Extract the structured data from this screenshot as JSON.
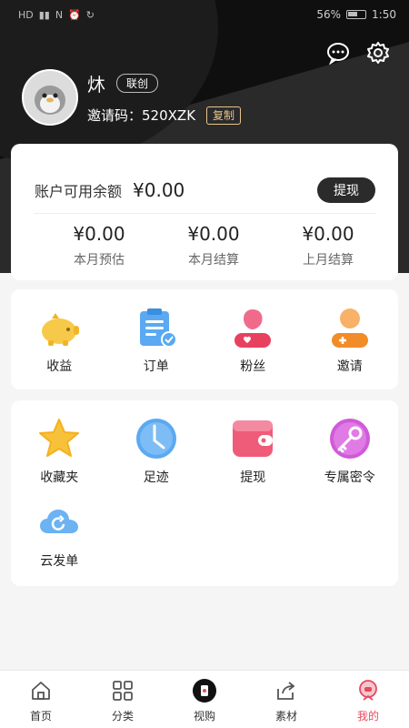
{
  "status_bar": {
    "battery_percent": "56%",
    "time": "1:50"
  },
  "profile": {
    "username": "炑",
    "role": "联创",
    "invite_label": "邀请码：",
    "invite_code": "520XZK",
    "copy_label": "复制"
  },
  "balance": {
    "label": "账户可用余额",
    "value": "¥0.00",
    "withdraw_label": "提现",
    "stats": [
      {
        "value": "¥0.00",
        "label": "本月预估"
      },
      {
        "value": "¥0.00",
        "label": "本月结算"
      },
      {
        "value": "¥0.00",
        "label": "上月结算"
      }
    ]
  },
  "menu1": [
    {
      "label": "收益",
      "icon": "piggy-bank-icon"
    },
    {
      "label": "订单",
      "icon": "clipboard-icon"
    },
    {
      "label": "粉丝",
      "icon": "fans-icon"
    },
    {
      "label": "邀请",
      "icon": "invite-user-icon"
    }
  ],
  "menu2": [
    {
      "label": "收藏夹",
      "icon": "star-icon"
    },
    {
      "label": "足迹",
      "icon": "clock-icon"
    },
    {
      "label": "提现",
      "icon": "wallet-icon"
    },
    {
      "label": "专属密令",
      "icon": "key-icon"
    },
    {
      "label": "云发单",
      "icon": "cloud-sync-icon"
    }
  ],
  "tabs": [
    {
      "label": "首页",
      "icon": "home-icon"
    },
    {
      "label": "分类",
      "icon": "grid-icon"
    },
    {
      "label": "视购",
      "icon": "video-shop-icon"
    },
    {
      "label": "素材",
      "icon": "share-icon"
    },
    {
      "label": "我的",
      "icon": "profile-icon",
      "active": true
    }
  ],
  "colors": {
    "accent": "#e64a5b",
    "header_bg": "#0f0f0f",
    "copy_gold": "#e7c58c"
  }
}
